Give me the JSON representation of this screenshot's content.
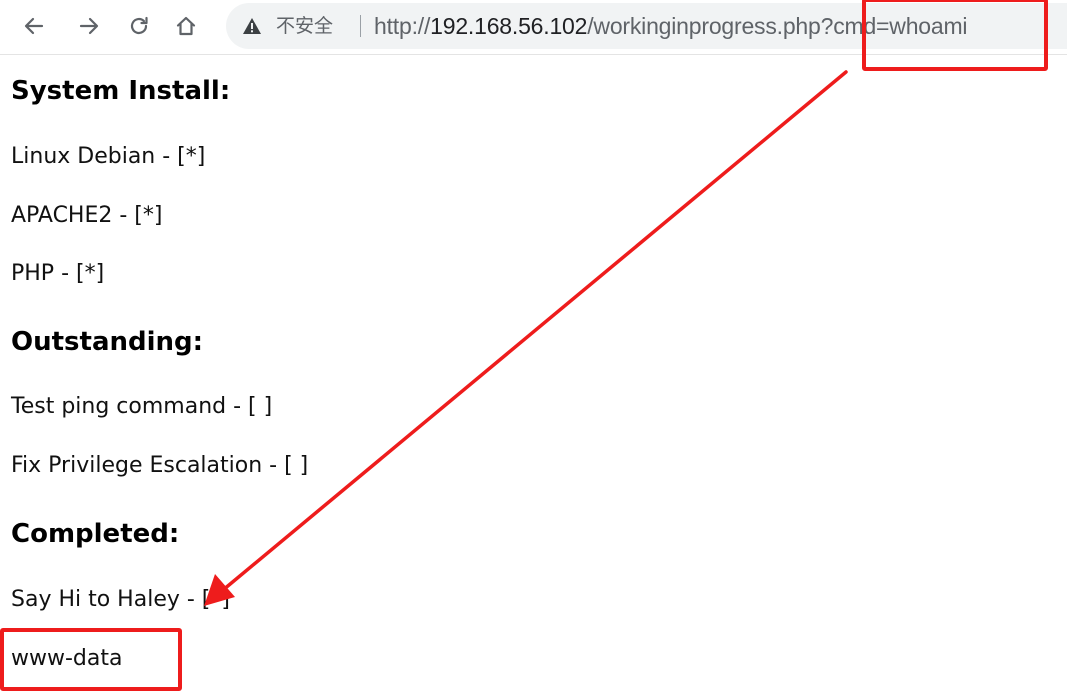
{
  "browser": {
    "security_label": "不安全",
    "url": {
      "scheme": "http://",
      "host": "192.168.56.102",
      "path": "/workinginprogress.php?cmd=whoami"
    },
    "icons": {
      "back": "arrow-left-icon",
      "forward": "arrow-right-icon",
      "reload": "reload-icon",
      "home": "home-icon",
      "security": "warning-triangle-icon"
    }
  },
  "page": {
    "sections": [
      {
        "heading": "System Install:",
        "items": [
          "Linux Debian - [*]",
          "APACHE2 - [*]",
          "PHP - [*]"
        ]
      },
      {
        "heading": "Outstanding:",
        "items": [
          "Test ping command - [ ]",
          "Fix Privilege Escalation - [ ]"
        ]
      },
      {
        "heading": "Completed:",
        "items": [
          "Say Hi to Haley - [*]"
        ]
      }
    ],
    "command_output": "www-data"
  },
  "annotation": {
    "color": "#ee1c1c"
  }
}
